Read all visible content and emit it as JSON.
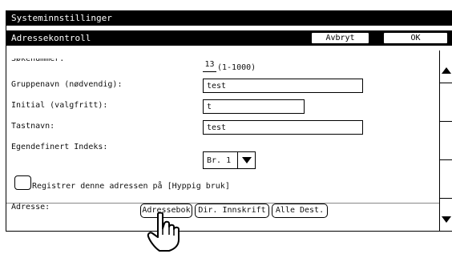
{
  "window": {
    "title": "Systeminnstillinger"
  },
  "header": {
    "title": "Adressekontroll",
    "cancel_label": "Avbryt",
    "ok_label": "OK"
  },
  "form": {
    "search_number_label": "Søkenummer:",
    "search_number_value": "13",
    "search_number_range": "(1-1000)",
    "group_name_label": "Gruppenavn (nødvendig):",
    "group_name_value": "test",
    "initial_label": "Initial (valgfritt):",
    "initial_value": "t",
    "key_name_label": "Tastnavn:",
    "key_name_value": "test",
    "custom_index_label": "Egendefinert Indeks:",
    "custom_index_value": "Br. 1",
    "frequent_use_label": "Registrer denne adressen på [Hyppig bruk]"
  },
  "address": {
    "label": "Adresse:",
    "buttons": [
      "Adressebok",
      "Dir. Innskrift",
      "Alle Dest."
    ]
  },
  "icons": {
    "scroll_up": "triangle-up-icon",
    "scroll_down": "triangle-down-icon",
    "dropdown": "triangle-down-icon",
    "pointer": "hand-pointer-icon"
  }
}
